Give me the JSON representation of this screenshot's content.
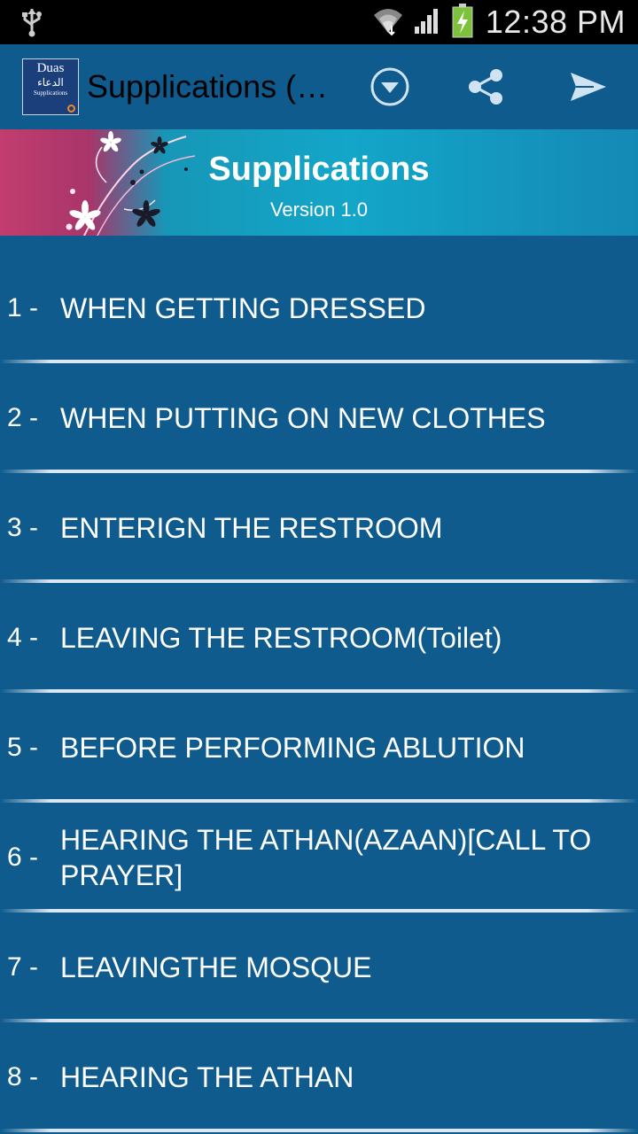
{
  "status_bar": {
    "time": "12:38 PM"
  },
  "action_bar": {
    "app_icon": {
      "line1": "Duas",
      "line2": "الدعاء",
      "line3": "Supplications"
    },
    "title": "Supplications (…",
    "buttons": [
      "chevron-down-icon",
      "share-icon",
      "send-icon"
    ]
  },
  "banner": {
    "title": "Supplications",
    "version": "Version 1.0"
  },
  "list": {
    "items": [
      {
        "num": "1 -",
        "label": "WHEN GETTING DRESSED"
      },
      {
        "num": "2 -",
        "label": "WHEN PUTTING ON NEW CLOTHES"
      },
      {
        "num": "3 -",
        "label": "ENTERIGN THE RESTROOM"
      },
      {
        "num": "4 -",
        "label": "LEAVING THE RESTROOM(Toilet)"
      },
      {
        "num": "5 -",
        "label": "BEFORE PERFORMING ABLUTION"
      },
      {
        "num": "6 -",
        "label": "HEARING THE ATHAN(AZAAN)[CALL TO PRAYER]"
      },
      {
        "num": "7 -",
        "label": "LEAVINGTHE MOSQUE"
      },
      {
        "num": "8 -",
        "label": "HEARING THE ATHAN"
      }
    ]
  },
  "colors": {
    "background": "#0f5b8e",
    "banner_pink": "#c23d6e",
    "banner_cyan": "#13a6c9"
  }
}
